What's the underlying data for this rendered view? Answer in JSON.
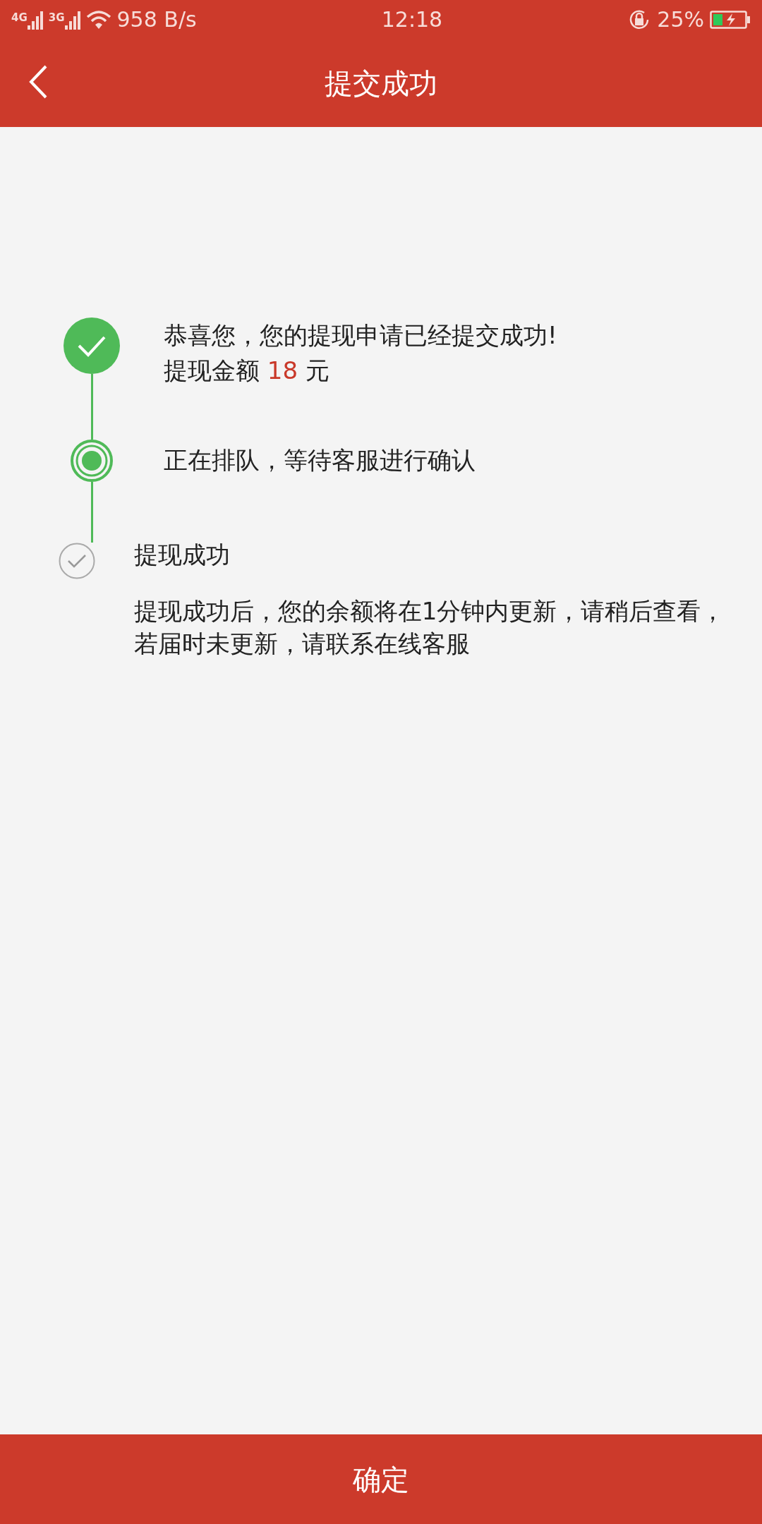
{
  "status_bar": {
    "network_1": "4G",
    "network_2": "3G",
    "speed": "958 B/s",
    "time": "12:18",
    "battery": "25%"
  },
  "header": {
    "title": "提交成功"
  },
  "steps": [
    {
      "kind": "done",
      "title": "恭喜您，您的提现申请已经提交成功!",
      "amount_label": "提现金额",
      "amount": "18",
      "amount_unit": "元"
    },
    {
      "kind": "current",
      "title": "正在排队，等待客服进行确认"
    },
    {
      "kind": "pending",
      "title": "提现成功",
      "note": "提现成功后，您的余额将在1分钟内更新，请稍后查看，若届时未更新，请联系在线客服"
    }
  ],
  "confirm_button": "确定"
}
